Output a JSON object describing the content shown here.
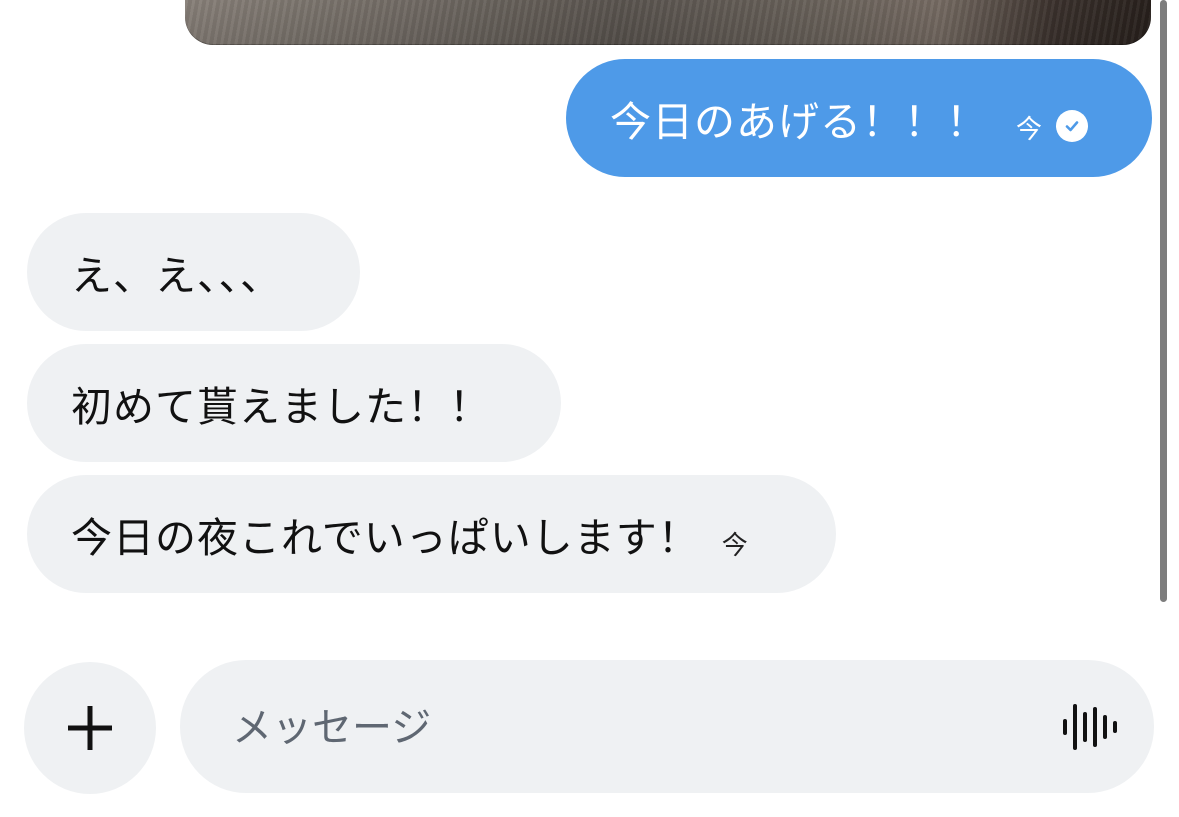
{
  "messages": {
    "sent": [
      {
        "text": "今日のあげる！！！",
        "time": "今",
        "status": "read"
      }
    ],
    "received": [
      {
        "text": "え、え、、、"
      },
      {
        "text": "初めて貰えました！！"
      },
      {
        "text": "今日の夜これでいっぱいします！",
        "time": "今"
      }
    ]
  },
  "composer": {
    "placeholder": "メッセージ",
    "add_icon": "plus-icon",
    "voice_icon": "voice-waveform-icon"
  },
  "colors": {
    "sent_bubble": "#4e9ae8",
    "received_bubble": "#eff1f3",
    "background": "#ffffff"
  }
}
